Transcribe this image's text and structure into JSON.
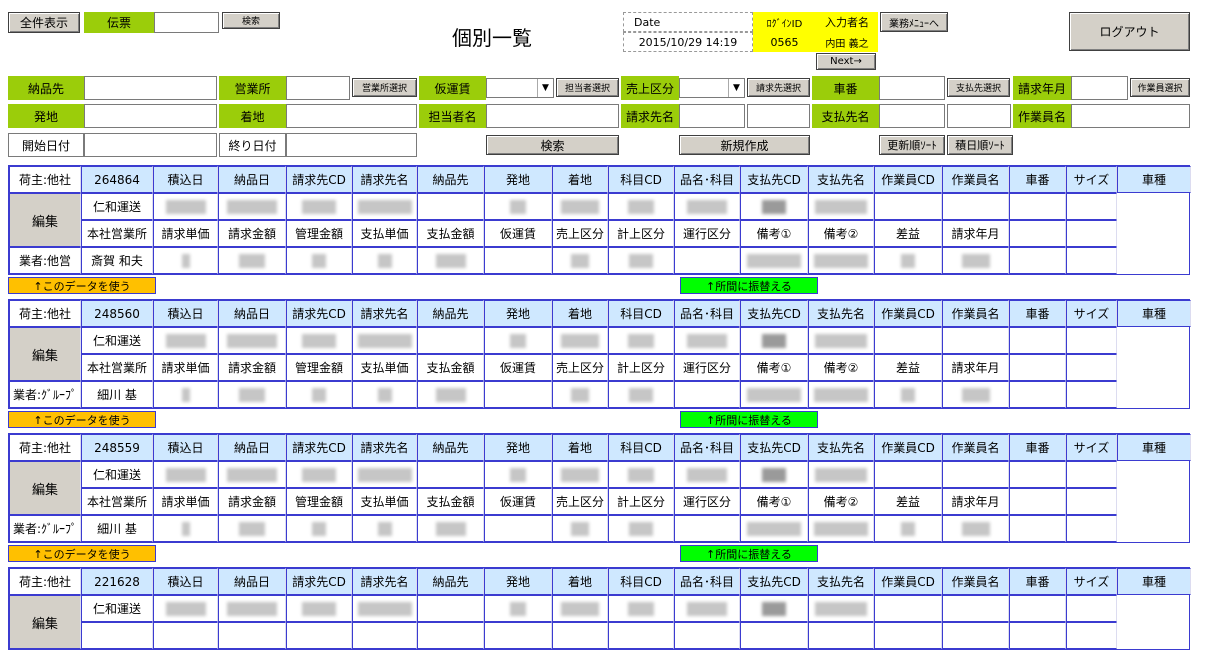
{
  "toolbar": {
    "show_all": "全件表示",
    "denpyo": "伝票",
    "denpyo_value": "",
    "search_small": "検索",
    "page_title": "個別一覧",
    "date_label": "Date",
    "date_value": "2015/10/29 14:19",
    "login_id_label": "ﾛｸﾞｲﾝID",
    "login_id_value": "0565",
    "inputter_label": "入力者名",
    "inputter_value": "内田 義之",
    "menu_button": "業務ﾒﾆｭｰへ",
    "next_button": "Next→",
    "logout": "ログアウト"
  },
  "form": {
    "nouhinsaki": "納品先",
    "eigyousho": "営業所",
    "eigyousho_select": "営業所選択",
    "kariunchin": "仮運賃",
    "tantousha_select": "担当者選択",
    "uriage_kubun": "売上区分",
    "seikyusaki_select": "請求先選択",
    "shaban": "車番",
    "shiharaisaki_select": "支払先選択",
    "seikyu_nengetsu": "請求年月",
    "sagyouin_select": "作業員選択",
    "hatchi": "発地",
    "chakuchi": "着地",
    "tantousha_mei": "担当者名",
    "seikyusaki_mei": "請求先名",
    "shiharaisaki_mei": "支払先名",
    "sagyouin_mei": "作業員名",
    "start_date": "開始日付",
    "end_date": "終り日付",
    "search": "検索",
    "new_create": "新規作成",
    "sort_updated": "更新順ｿｰﾄ",
    "sort_loaded": "積日順ｿｰﾄ"
  },
  "headers": {
    "row1": [
      "積込日",
      "納品日",
      "請求先CD",
      "請求先名",
      "納品先",
      "発地",
      "着地",
      "科目CD",
      "品名･科目",
      "支払先CD",
      "支払先名",
      "作業員CD",
      "作業員名",
      "車番",
      "サイズ",
      "車種"
    ],
    "row3": [
      "請求単価",
      "請求金額",
      "管理金額",
      "支払単価",
      "支払金額",
      "仮運賃",
      "売上区分",
      "計上区分",
      "運行区分",
      "備考①",
      "備考②",
      "差益",
      "請求年月"
    ]
  },
  "edit_label": "編集",
  "use_data": "↑このデータを使う",
  "move_office": "↑所間に振替える",
  "records": [
    {
      "owner": "荷主:他社",
      "id": "264864",
      "company": "仁和運送",
      "office": "本社営業所",
      "vendor": "業者:他営",
      "person": "斎賀 和夫"
    },
    {
      "owner": "荷主:他社",
      "id": "248560",
      "company": "仁和運送",
      "office": "本社営業所",
      "vendor": "業者:ｸﾞﾙｰﾌﾟ",
      "person": "細川 基"
    },
    {
      "owner": "荷主:他社",
      "id": "248559",
      "company": "仁和運送",
      "office": "本社営業所",
      "vendor": "業者:ｸﾞﾙｰﾌﾟ",
      "person": "細川 基"
    },
    {
      "owner": "荷主:他社",
      "id": "221628",
      "company": "仁和運送",
      "office": "",
      "vendor": "",
      "person": ""
    }
  ],
  "colors": {
    "green_label": "#9bcd0a",
    "header_blue": "#cfe8ff",
    "border_blue": "#3b3bd0",
    "yellow": "#ffff00",
    "use_orange": "#ffc000",
    "move_green": "#00ff00"
  }
}
